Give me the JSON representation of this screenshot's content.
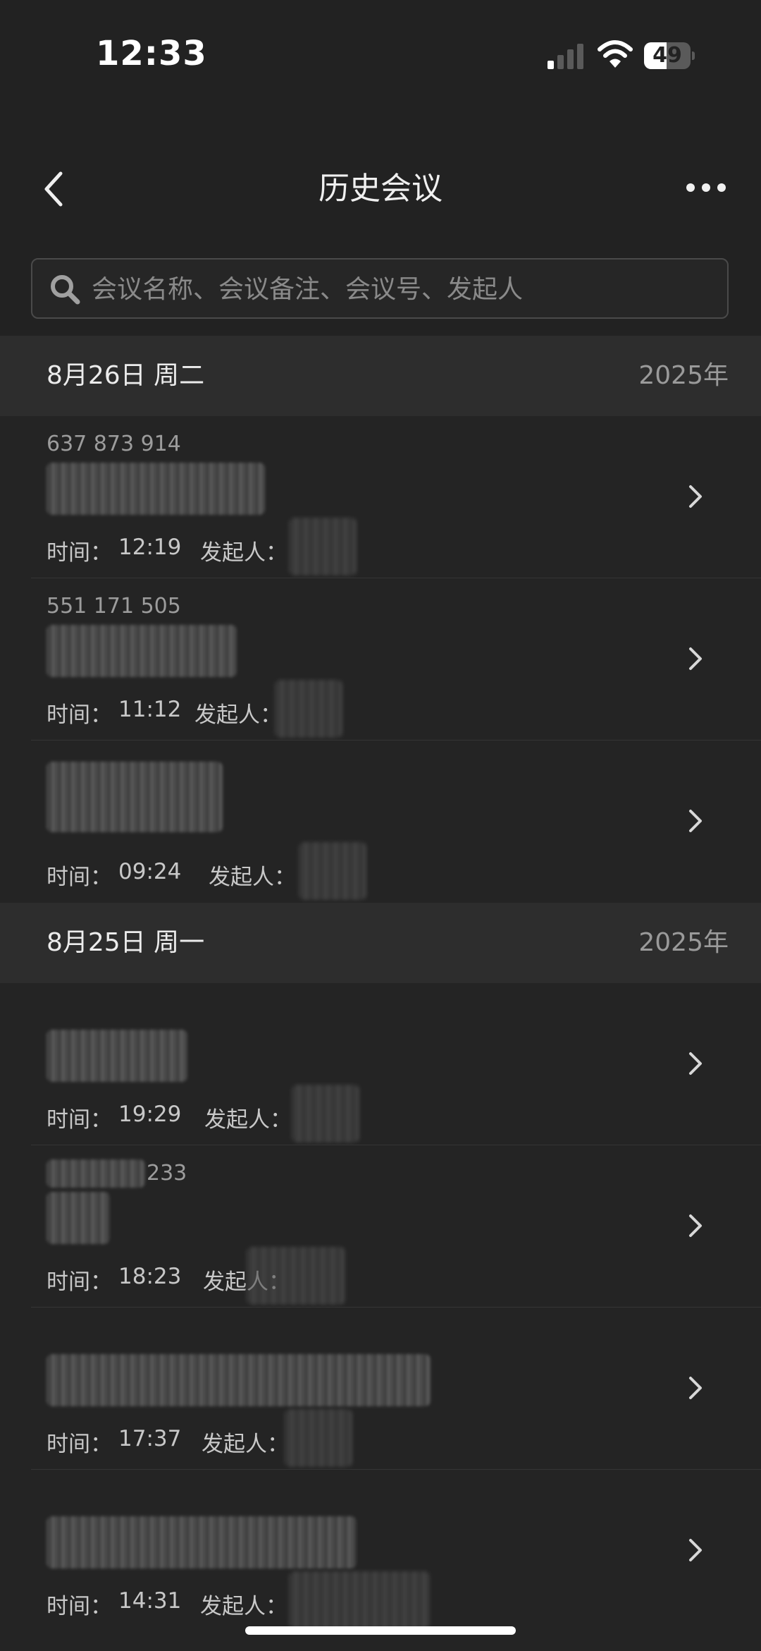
{
  "status": {
    "time": "12:33",
    "battery_level": "49",
    "battery_fraction": 0.49
  },
  "nav": {
    "title": "历史会议",
    "back_icon": "chevron-left-icon",
    "more_icon": "more-horizontal-icon"
  },
  "search": {
    "placeholder": "会议名称、会议备注、会议号、发起人",
    "value": ""
  },
  "labels": {
    "time_label": "时间：",
    "host_label": "发起人："
  },
  "sections": [
    {
      "date": "8月26日 周二",
      "year": "2025年",
      "meetings": [
        {
          "id": "637 873 914",
          "time": "12:19"
        },
        {
          "id": "551 171 505",
          "time": "11:12"
        },
        {
          "id": "",
          "time": "09:24"
        }
      ]
    },
    {
      "date": "8月25日 周一",
      "year": "2025年",
      "meetings": [
        {
          "id": "",
          "time": "19:29"
        },
        {
          "id": "233",
          "time": "18:23"
        },
        {
          "id": "",
          "time": "17:37"
        },
        {
          "id": "",
          "time": "14:31"
        }
      ]
    }
  ]
}
